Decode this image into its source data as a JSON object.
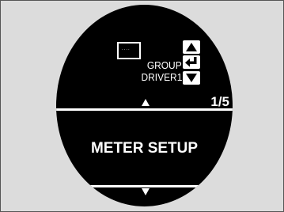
{
  "screen": {
    "background_color": "#dcdcdc",
    "display_color": "#000000",
    "text_color": "#ffffff"
  },
  "header": {
    "group_icon": "group-card-icon",
    "group_label": "GROUP",
    "driver_label": "DRIVER1"
  },
  "controls": {
    "up_icon": "triangle-up-icon",
    "enter_icon": "enter-return-icon",
    "down_icon": "triangle-down-icon"
  },
  "pager": {
    "up_indicator_icon": "triangle-up-icon",
    "page_text": "1/5",
    "down_indicator_icon": "triangle-down-icon"
  },
  "menu": {
    "current_item": "METER SETUP"
  }
}
